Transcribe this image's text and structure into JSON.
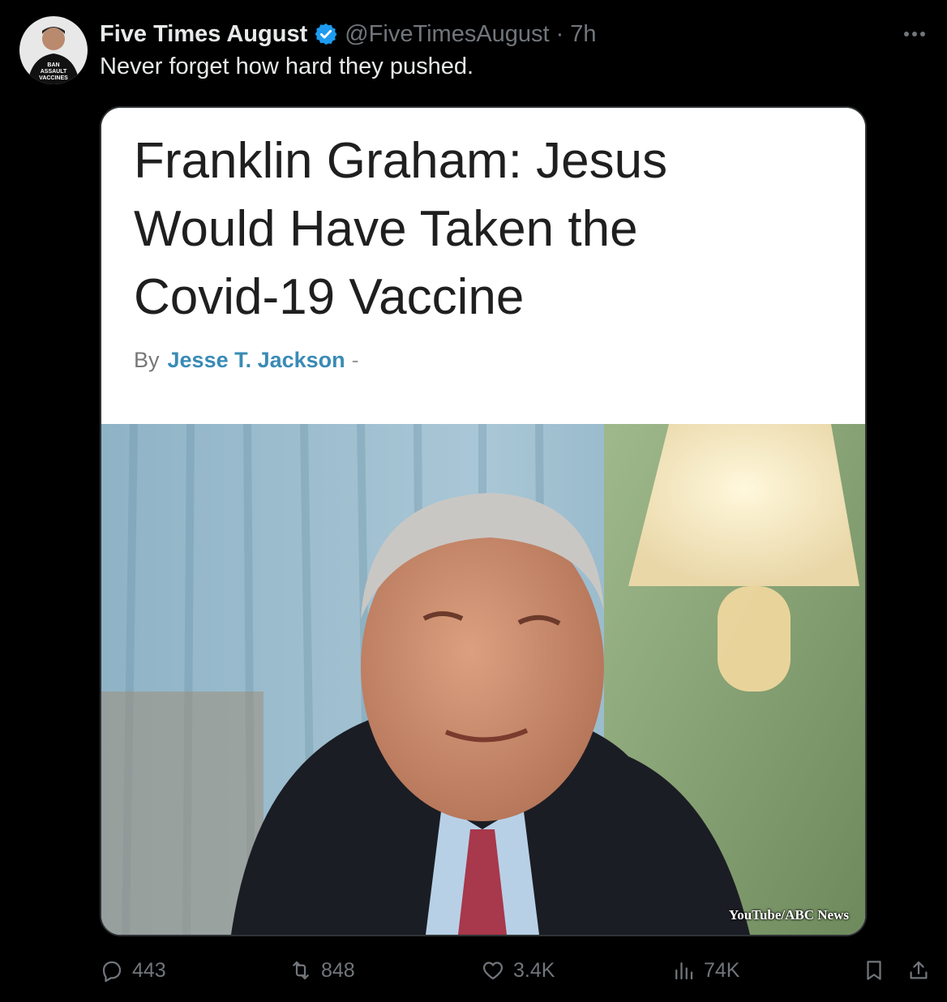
{
  "tweet": {
    "display_name": "Five Times August",
    "handle": "@FiveTimesAugust",
    "separator": "·",
    "time": "7h",
    "text": "Never forget how hard they pushed.",
    "avatar_shirt_text": [
      "BAN",
      "ASSAULT",
      "VACCINES"
    ],
    "verified_color": "#1d9bf0"
  },
  "article": {
    "headline_lines": [
      "Franklin Graham: Jesus",
      "Would Have Taken the",
      "Covid-19 Vaccine"
    ],
    "byline_prefix": "By",
    "author": "Jesse T. Jackson",
    "byline_suffix": "-",
    "photo_credit": "YouTube/ABC News"
  },
  "actions": {
    "replies": "443",
    "reposts": "848",
    "likes": "3.4K",
    "views": "74K"
  },
  "icons": {
    "more": "more-icon",
    "reply": "reply-icon",
    "repost": "repost-icon",
    "like": "heart-icon",
    "views": "views-icon",
    "bookmark": "bookmark-icon",
    "share": "share-icon"
  }
}
